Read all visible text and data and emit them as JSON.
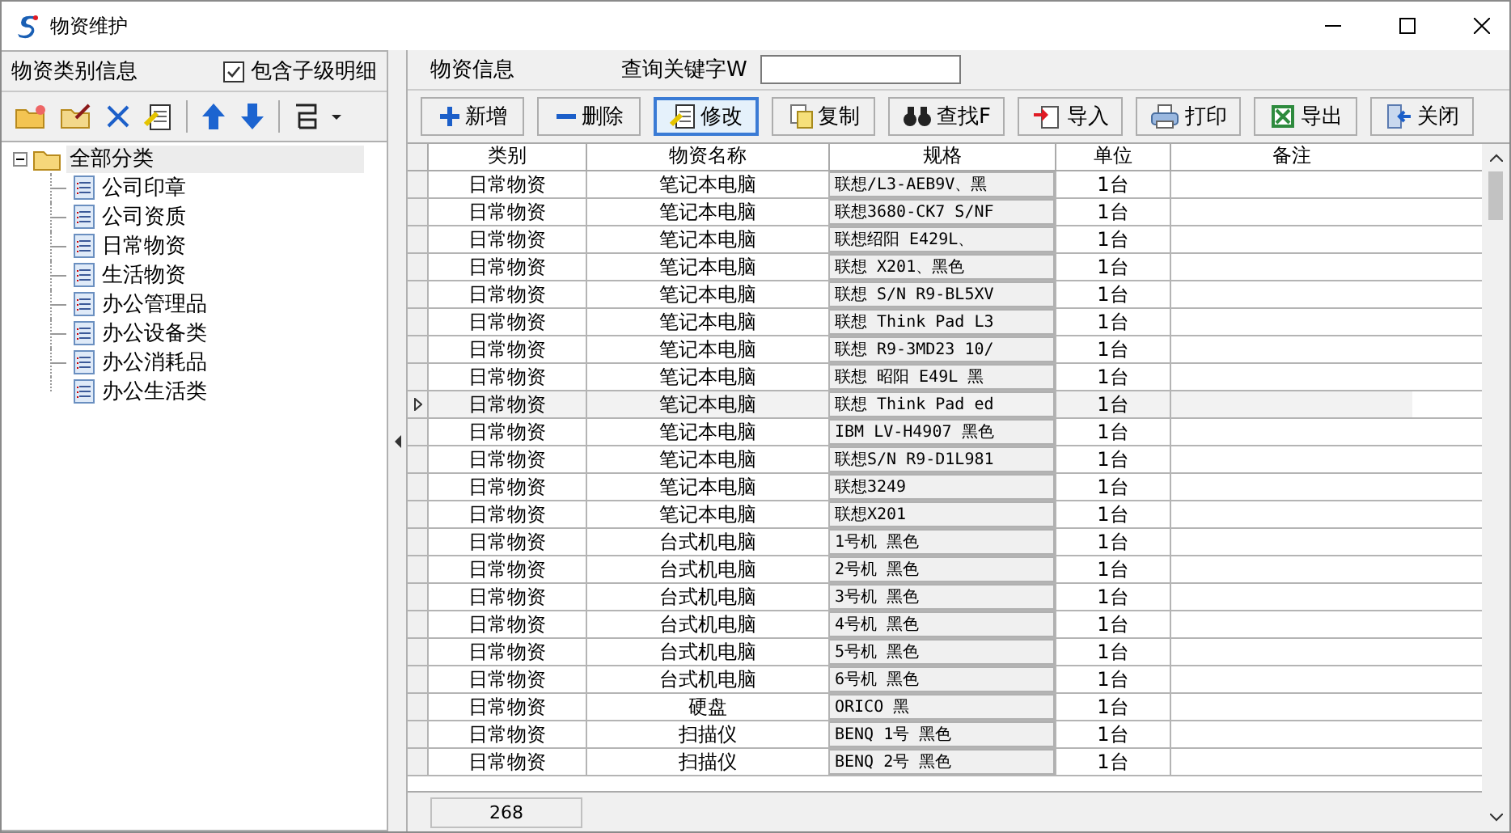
{
  "window": {
    "title": "物资维护"
  },
  "left_panel": {
    "title": "物资类别信息",
    "include_children": {
      "label": "包含子级明细",
      "checked": true
    }
  },
  "tree": [
    {
      "label": "全部分类",
      "expanded": true,
      "selected": true,
      "children": [
        {
          "label": "公司印章",
          "selected": false
        },
        {
          "label": "公司资质",
          "selected": false
        },
        {
          "label": "日常物资",
          "selected": false
        },
        {
          "label": "生活物资",
          "selected": false
        },
        {
          "label": "办公管理品",
          "selected": false
        },
        {
          "label": "办公设备类",
          "selected": false
        },
        {
          "label": "办公消耗品",
          "selected": false
        },
        {
          "label": "办公生活类",
          "selected": false
        }
      ]
    }
  ],
  "right_panel": {
    "title": "物资信息",
    "search": {
      "label": "查询关键字W"
    }
  },
  "buttons": [
    {
      "label": "新增",
      "focused": false
    },
    {
      "label": "删除",
      "focused": false
    },
    {
      "label": "修改",
      "focused": true
    },
    {
      "label": "复制",
      "focused": false
    },
    {
      "label": "查找F",
      "focused": false
    },
    {
      "label": "导入",
      "focused": false
    },
    {
      "label": "打印",
      "focused": false
    },
    {
      "label": "导出",
      "focused": false
    },
    {
      "label": "关闭",
      "focused": false
    }
  ],
  "table": {
    "columns": [
      "类别",
      "物资名称",
      "规格",
      "单位",
      "备注"
    ],
    "rows": [
      {
        "cells": [
          "日常物资",
          "笔记本电脑",
          "联想/L3-AEB9V、黑",
          "1台",
          ""
        ],
        "selected": false
      },
      {
        "cells": [
          "日常物资",
          "笔记本电脑",
          "联想3680-CK7 S/NF",
          "1台",
          ""
        ],
        "selected": false
      },
      {
        "cells": [
          "日常物资",
          "笔记本电脑",
          "联想绍阳 E429L、",
          "1台",
          ""
        ],
        "selected": false
      },
      {
        "cells": [
          "日常物资",
          "笔记本电脑",
          "联想 X201、黑色",
          "1台",
          ""
        ],
        "selected": false
      },
      {
        "cells": [
          "日常物资",
          "笔记本电脑",
          "联想 S/N R9-BL5XV",
          "1台",
          ""
        ],
        "selected": false
      },
      {
        "cells": [
          "日常物资",
          "笔记本电脑",
          "联想 Think Pad L3",
          "1台",
          ""
        ],
        "selected": false
      },
      {
        "cells": [
          "日常物资",
          "笔记本电脑",
          "联想 R9-3MD23 10/",
          "1台",
          ""
        ],
        "selected": false
      },
      {
        "cells": [
          "日常物资",
          "笔记本电脑",
          "联想 昭阳 E49L 黑",
          "1台",
          ""
        ],
        "selected": false
      },
      {
        "cells": [
          "日常物资",
          "笔记本电脑",
          "联想 Think Pad ed",
          "1台",
          ""
        ],
        "selected": true
      },
      {
        "cells": [
          "日常物资",
          "笔记本电脑",
          "IBM LV-H4907 黑色",
          "1台",
          ""
        ],
        "selected": false
      },
      {
        "cells": [
          "日常物资",
          "笔记本电脑",
          "联想S/N R9-D1L981",
          "1台",
          ""
        ],
        "selected": false
      },
      {
        "cells": [
          "日常物资",
          "笔记本电脑",
          "联想3249",
          "1台",
          ""
        ],
        "selected": false
      },
      {
        "cells": [
          "日常物资",
          "笔记本电脑",
          "联想X201",
          "1台",
          ""
        ],
        "selected": false
      },
      {
        "cells": [
          "日常物资",
          "台式机电脑",
          "1号机  黑色",
          "1台",
          ""
        ],
        "selected": false
      },
      {
        "cells": [
          "日常物资",
          "台式机电脑",
          "2号机  黑色",
          "1台",
          ""
        ],
        "selected": false
      },
      {
        "cells": [
          "日常物资",
          "台式机电脑",
          "3号机  黑色",
          "1台",
          ""
        ],
        "selected": false
      },
      {
        "cells": [
          "日常物资",
          "台式机电脑",
          "4号机  黑色",
          "1台",
          ""
        ],
        "selected": false
      },
      {
        "cells": [
          "日常物资",
          "台式机电脑",
          "5号机  黑色",
          "1台",
          ""
        ],
        "selected": false
      },
      {
        "cells": [
          "日常物资",
          "台式机电脑",
          "6号机  黑色",
          "1台",
          ""
        ],
        "selected": false
      },
      {
        "cells": [
          "日常物资",
          "硬盘",
          "ORICO 黑",
          "1台",
          ""
        ],
        "selected": false
      },
      {
        "cells": [
          "日常物资",
          "扫描仪",
          "BENQ 1号  黑色",
          "1台",
          ""
        ],
        "selected": false
      },
      {
        "cells": [
          "日常物资",
          "扫描仪",
          "BENQ 2号  黑色",
          "1台",
          ""
        ],
        "selected": false
      }
    ]
  },
  "footer": {
    "count": "268"
  }
}
